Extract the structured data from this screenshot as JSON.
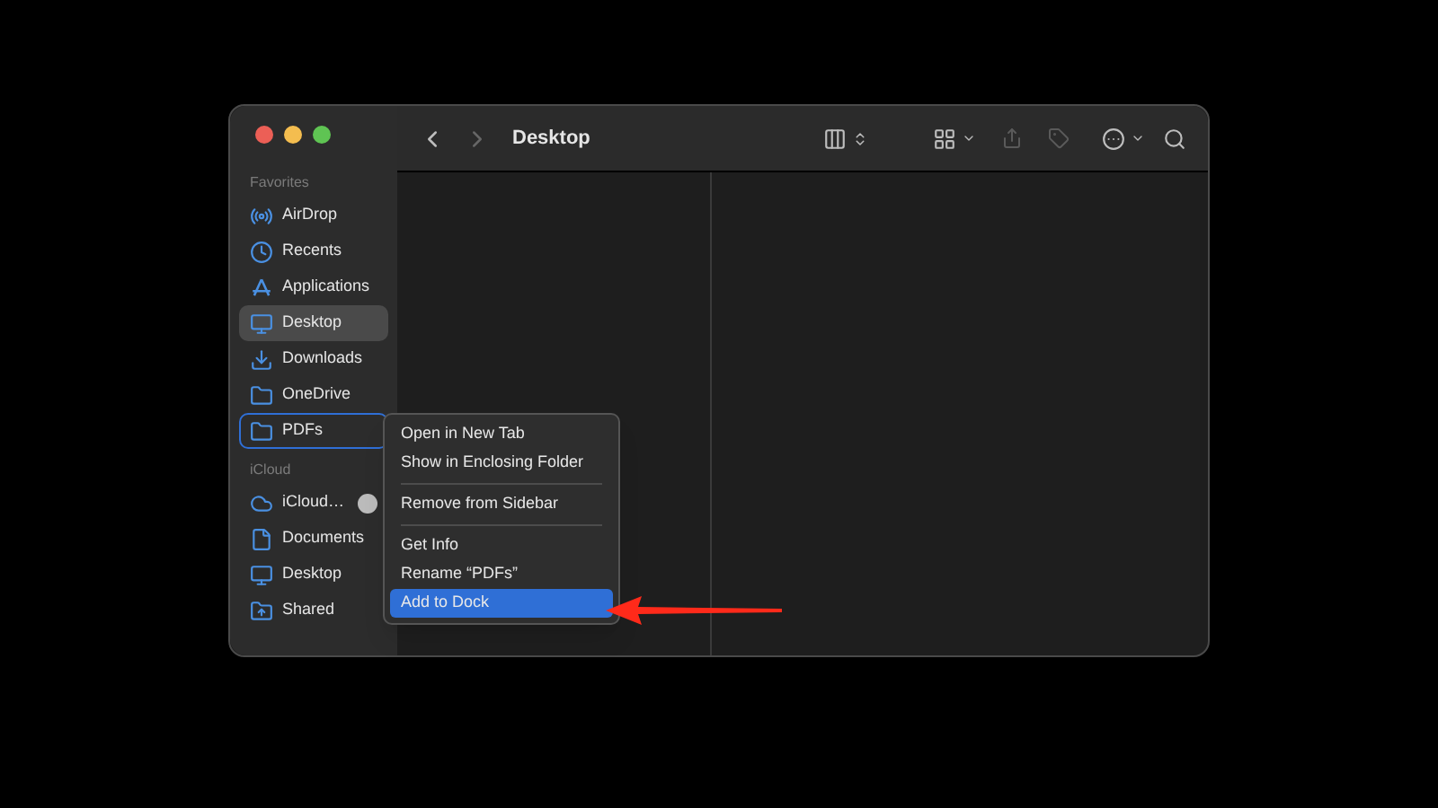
{
  "window": {
    "title": "Desktop"
  },
  "sidebar": {
    "sections": [
      {
        "heading": "Favorites",
        "items": [
          {
            "kind": "airdrop",
            "label": "AirDrop",
            "selected": false,
            "targeted": false
          },
          {
            "kind": "clock",
            "label": "Recents",
            "selected": false,
            "targeted": false
          },
          {
            "kind": "apps",
            "label": "Applications",
            "selected": false,
            "targeted": false
          },
          {
            "kind": "desktop",
            "label": "Desktop",
            "selected": true,
            "targeted": false
          },
          {
            "kind": "download",
            "label": "Downloads",
            "selected": false,
            "targeted": false
          },
          {
            "kind": "folder",
            "label": "OneDrive",
            "selected": false,
            "targeted": false
          },
          {
            "kind": "folder",
            "label": "PDFs",
            "selected": false,
            "targeted": true
          }
        ]
      },
      {
        "heading": "iCloud",
        "items": [
          {
            "kind": "cloud",
            "label": "iCloud…",
            "selected": false,
            "targeted": false,
            "progress": true
          },
          {
            "kind": "doc",
            "label": "Documents",
            "selected": false,
            "targeted": false
          },
          {
            "kind": "desktop",
            "label": "Desktop",
            "selected": false,
            "targeted": false
          },
          {
            "kind": "shared",
            "label": "Shared",
            "selected": false,
            "targeted": false
          }
        ]
      }
    ]
  },
  "context_menu": {
    "groups": [
      [
        {
          "label": "Open in New Tab",
          "selected": false
        },
        {
          "label": "Show in Enclosing Folder",
          "selected": false
        }
      ],
      [
        {
          "label": "Remove from Sidebar",
          "selected": false
        }
      ],
      [
        {
          "label": "Get Info",
          "selected": false
        },
        {
          "label": "Rename “PDFs”",
          "selected": false
        },
        {
          "label": "Add to Dock",
          "selected": true
        }
      ]
    ]
  }
}
